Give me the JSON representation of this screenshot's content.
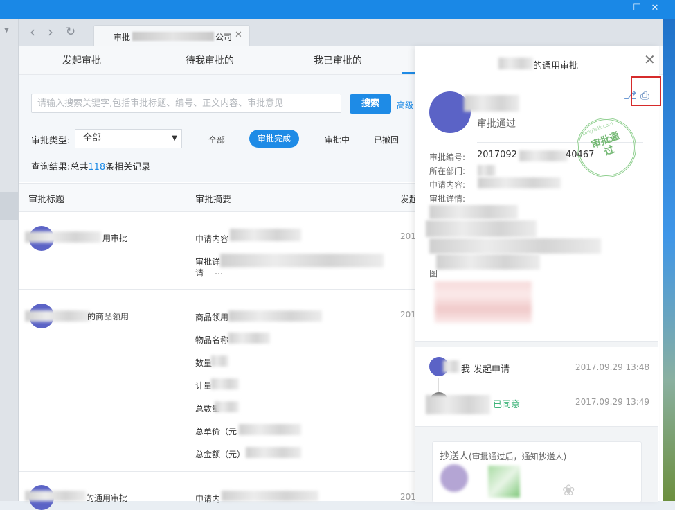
{
  "window": {
    "minimize": "—",
    "maximize": "☐",
    "close": "✕"
  },
  "browser": {
    "tab_prefix": "审批",
    "tab_suffix": "公司",
    "tab_close": "✕",
    "back": "‹",
    "forward": "›",
    "refresh": "↻"
  },
  "app_tabs": [
    "发起审批",
    "待我审批的",
    "我已审批的"
  ],
  "search": {
    "placeholder": "请输入搜索关键字,包括审批标题、编号、正文内容、审批意见",
    "button": "搜索",
    "advanced": "高级"
  },
  "filter": {
    "type_label": "审批类型:",
    "type_value": "全部",
    "options": [
      "全部",
      "审批完成",
      "审批中",
      "已撤回"
    ],
    "active": "审批完成"
  },
  "result": {
    "prefix": "查询结果:总共",
    "count": "118",
    "suffix": "条相关记录"
  },
  "table": {
    "headers": [
      "审批标题",
      "审批摘要",
      "发起"
    ],
    "rows": [
      {
        "title": "用审批",
        "lines": [
          "申请内容",
          "审批详",
          "请",
          "…"
        ],
        "date": "201"
      },
      {
        "title": "的商品领用",
        "lines": [
          "商品领用",
          "物品名称",
          "数量",
          "计量",
          "总数量",
          "总单价（元",
          "总金额（元）"
        ],
        "date": "201"
      },
      {
        "title": "的通用审批",
        "lines": [
          "申请内"
        ],
        "date": "201"
      }
    ]
  },
  "panel": {
    "title_suffix": "的通用审批",
    "close": "✕",
    "status": "审批通过",
    "stamp_text": "审批通过",
    "stamp_small": "DingTalk.com",
    "fields": [
      {
        "label": "审批编号:",
        "value_start": "2017092",
        "value_end": "40467"
      },
      {
        "label": "所在部门:",
        "value_start": "",
        "value_end": ""
      },
      {
        "label": "申请内容:",
        "value_start": "",
        "value_end": ""
      },
      {
        "label": "审批详情:",
        "value_start": "",
        "value_end": ""
      }
    ],
    "image_label": "图",
    "timeline": [
      {
        "who": "我",
        "action": "发起申请",
        "time": "2017.09.29 13:48"
      },
      {
        "who": "",
        "action": "已同意",
        "time": "2017.09.29 13:49"
      }
    ],
    "cc": {
      "title": "抄送人",
      "note": "(审批通过后，通知抄送人)"
    }
  },
  "colors": {
    "accent": "#1e8be6",
    "approved_green": "#3fb47a",
    "avatar": "#5b63c6",
    "highlight_red": "#d62b2b"
  }
}
